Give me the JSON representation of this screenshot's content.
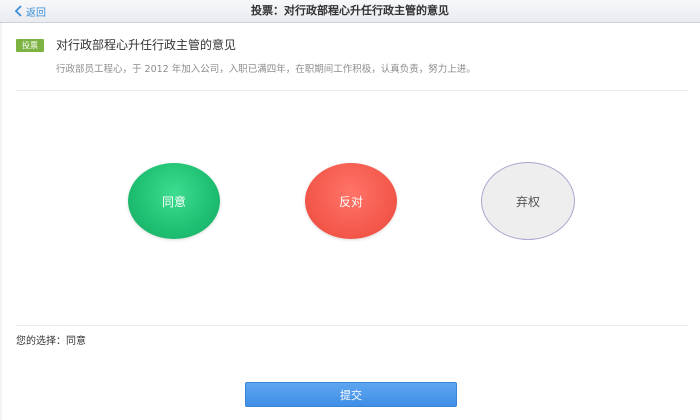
{
  "nav": {
    "back_label": "返回",
    "title": "投票：对行政部程心升任行政主管的意见"
  },
  "topic": {
    "badge": "投票",
    "title": "对行政部程心升任行政主管的意见",
    "description": "行政部员工程心，于 2012 年加入公司，入职已满四年，在职期间工作积极，认真负责，努力上进。"
  },
  "options": {
    "agree": "同意",
    "oppose": "反对",
    "abstain": "弃权"
  },
  "selection": {
    "text": "您的选择：同意"
  },
  "submit_label": "提交",
  "colors": {
    "agree": "#1fbf72",
    "oppose": "#f45a4d",
    "abstain_bg": "#eeeeee",
    "abstain_border": "#a9a6d0",
    "accent": "#3f8ee6",
    "badge": "#7cb342"
  }
}
